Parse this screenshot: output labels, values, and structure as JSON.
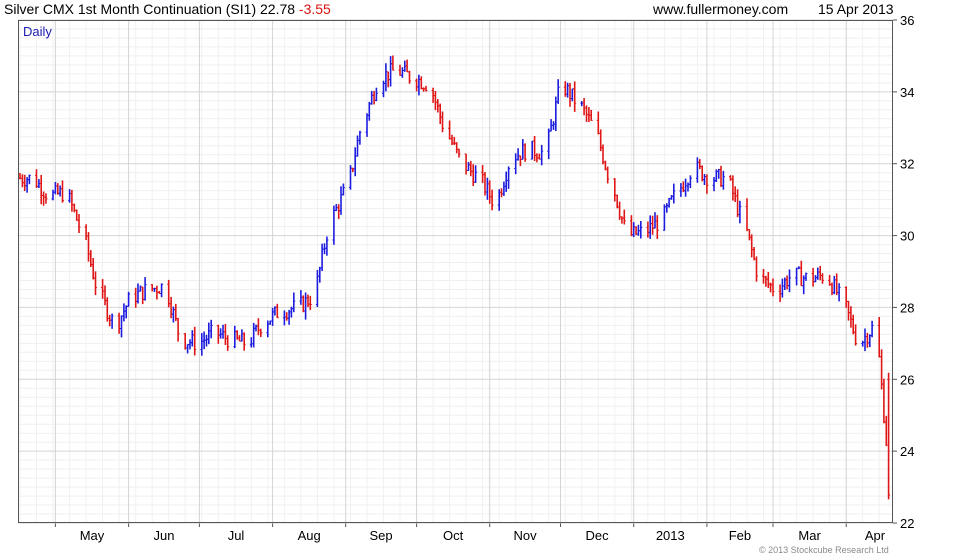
{
  "header": {
    "title": "Silver CMX 1st Month Continuation (SI1) 22.78",
    "change": "-3.55",
    "site": "www.fullermoney.com",
    "date": "15 Apr 2013"
  },
  "footer": {
    "credit": "© 2013 Stockcube Research Ltd"
  },
  "colors": {
    "up": "#1c1ce0",
    "down": "#e01616",
    "grid": "#d4d4d4",
    "frame": "#555555",
    "header_change": "#d81313"
  },
  "chart_data": {
    "type": "line",
    "interval_label": "Daily",
    "x_tick_labels": [
      "May",
      "Jun",
      "Jul",
      "Aug",
      "Sep",
      "Oct",
      "Nov",
      "Dec",
      "2013",
      "Feb",
      "Mar",
      "Apr"
    ],
    "y_ticks": [
      22,
      24,
      26,
      28,
      30,
      32,
      34,
      36
    ],
    "ylim": [
      22,
      36
    ],
    "y_axis_side": "right",
    "grid": true,
    "bar_style": "OHLC bars, blue = up day, red = down day",
    "series": [
      {
        "x": [
          "2012-04-16",
          "2012-04-23",
          "2012-04-30",
          "2012-05-07",
          "2012-05-14",
          "2012-05-21",
          "2012-05-28",
          "2012-06-04",
          "2012-06-11",
          "2012-06-18",
          "2012-06-25",
          "2012-07-02",
          "2012-07-09",
          "2012-07-16",
          "2012-07-23",
          "2012-07-30",
          "2012-08-06",
          "2012-08-13",
          "2012-08-20",
          "2012-08-27",
          "2012-09-03",
          "2012-09-10",
          "2012-09-17",
          "2012-09-24",
          "2012-10-01",
          "2012-10-08",
          "2012-10-15",
          "2012-10-22",
          "2012-10-29",
          "2012-11-05",
          "2012-11-12",
          "2012-11-19",
          "2012-11-26",
          "2012-12-03",
          "2012-12-10",
          "2012-12-17",
          "2012-12-24",
          "2012-12-31",
          "2013-01-07",
          "2013-01-14",
          "2013-01-21",
          "2013-01-28",
          "2013-02-04",
          "2013-02-11",
          "2013-02-18",
          "2013-02-25",
          "2013-03-04",
          "2013-03-11",
          "2013-03-18",
          "2013-03-25",
          "2013-04-01",
          "2013-04-08",
          "2013-04-15"
        ],
        "values": [
          31.6,
          31.1,
          31.2,
          30.1,
          28.4,
          27.5,
          28.3,
          28.5,
          28.6,
          27.1,
          27.0,
          27.3,
          27.1,
          27.0,
          27.6,
          27.9,
          28.0,
          28.3,
          30.4,
          31.3,
          33.2,
          34.4,
          34.6,
          34.4,
          34.2,
          32.9,
          32.0,
          31.6,
          30.9,
          32.2,
          32.4,
          32.3,
          34.2,
          33.7,
          33.0,
          31.5,
          30.0,
          30.1,
          30.4,
          31.2,
          31.9,
          31.6,
          31.6,
          30.4,
          28.8,
          28.5,
          28.9,
          28.8,
          28.9,
          28.2,
          27.0,
          27.5,
          22.78
        ]
      }
    ]
  }
}
